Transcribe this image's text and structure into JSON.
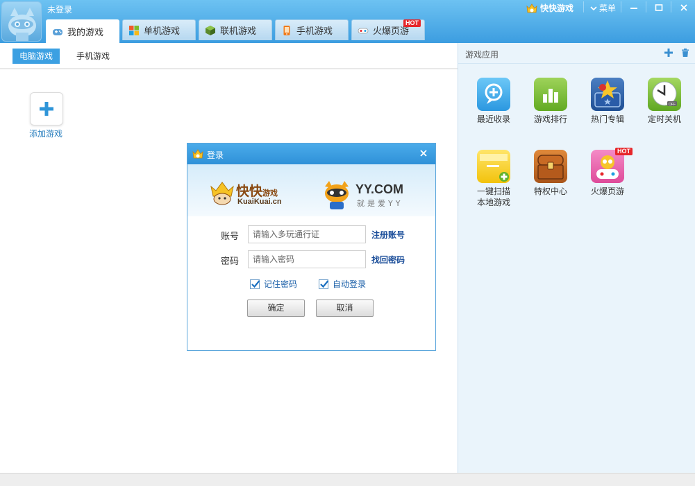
{
  "header": {
    "user_status": "未登录",
    "brand": "快快游戏",
    "menu_label": "菜单"
  },
  "tabs": [
    {
      "label": "我的游戏",
      "icon": "gamepad-icon",
      "active": true
    },
    {
      "label": "单机游戏",
      "icon": "windows-grid-icon"
    },
    {
      "label": "联机游戏",
      "icon": "cube-icon"
    },
    {
      "label": "手机游戏",
      "icon": "phone-icon"
    },
    {
      "label": "火爆页游",
      "icon": "controller-icon",
      "badge": "HOT"
    }
  ],
  "subtabs": [
    {
      "label": "电脑游戏",
      "active": true
    },
    {
      "label": "手机游戏"
    }
  ],
  "main": {
    "add_game_label": "添加游戏"
  },
  "right_panel": {
    "title": "游戏应用",
    "apps": [
      {
        "label": "最近收录",
        "icon": "recent-add-icon"
      },
      {
        "label": "游戏排行",
        "icon": "ranking-icon"
      },
      {
        "label": "热门专辑",
        "icon": "hot-album-icon"
      },
      {
        "label": "定时关机",
        "icon": "timer-shutdown-icon",
        "sub": "OFF"
      },
      {
        "label": "一键扫描本地游戏",
        "line1": "一键扫描",
        "line2": "本地游戏",
        "icon": "scan-folder-icon"
      },
      {
        "label": "特权中心",
        "icon": "treasure-chest-icon"
      },
      {
        "label": "火爆页游",
        "icon": "hot-webgame-icon",
        "badge": "HOT"
      }
    ]
  },
  "dialog": {
    "title": "登录",
    "kk_logo_text": "快快游戏",
    "kk_logo_main": "快快",
    "kk_logo_sub": "游戏",
    "kk_logo_url": "KuaiKuai.cn",
    "yy_logo_text": "YY.COM",
    "yy_logo_slogan": "就是爱YY",
    "account_label": "账号",
    "account_placeholder": "请输入多玩通行证",
    "account_value": "",
    "register_link": "注册账号",
    "password_label": "密码",
    "password_placeholder": "请输入密码",
    "password_value": "",
    "recover_link": "找回密码",
    "remember_label": "记住密码",
    "remember_checked": true,
    "autologin_label": "自动登录",
    "autologin_checked": true,
    "ok_label": "确定",
    "cancel_label": "取消"
  },
  "colors": {
    "title_bar": "#3c9de0",
    "accent": "#3ca0e2",
    "link": "#1a4d99",
    "hot_badge": "#e6262a"
  }
}
